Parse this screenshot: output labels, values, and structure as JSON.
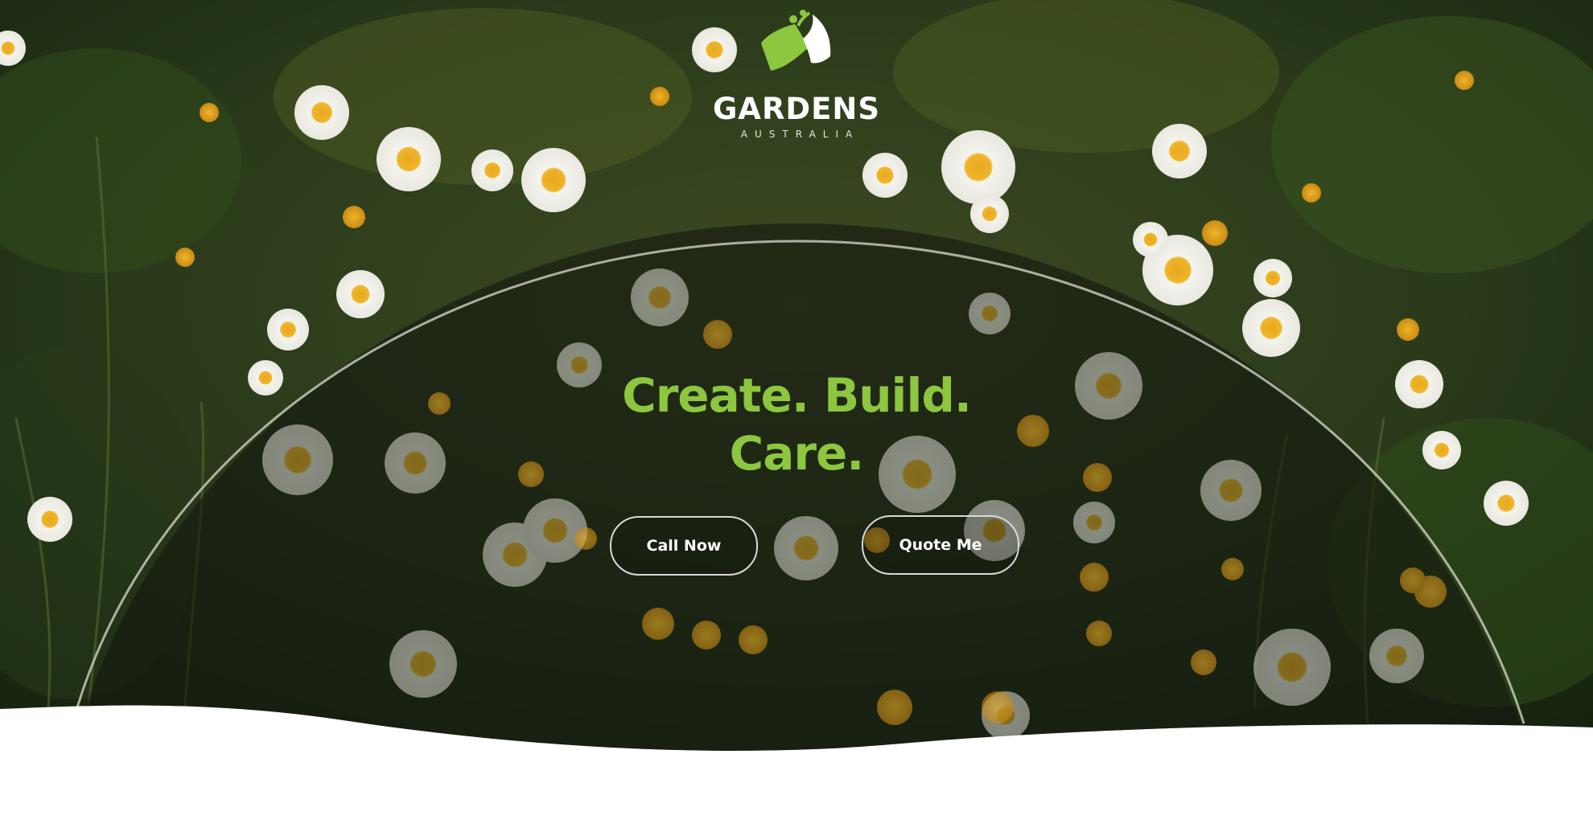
{
  "brand": {
    "name": "GARDENS",
    "tagline": "AUSTRALIA",
    "accent_color": "#8dc63f"
  },
  "hero": {
    "headline_line1": "Create. Build.",
    "headline_line2": "Care.",
    "background": "wildflower-meadow-photo"
  },
  "buttons": {
    "call_label": "Call Now",
    "quote_label": "Quote Me"
  }
}
